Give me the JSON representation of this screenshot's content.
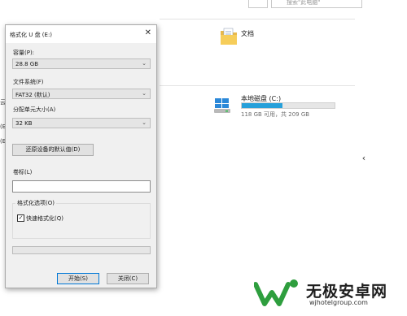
{
  "explorer": {
    "search_placeholder": "搜索\"此电脑\"",
    "folders": [
      {
        "name": "文档",
        "icon": "document-folder-icon"
      }
    ],
    "drives": [
      {
        "name": "本地磁盘 (C:)",
        "usage": "118 GB 可用，共 209 GB",
        "used_fraction": 0.44,
        "icon": "hard-drive-icon"
      }
    ],
    "left_remnants": [
      "云",
      "(E",
      "(E"
    ],
    "colors": {
      "drive_bar": "#26a0da",
      "background": "#ffffff"
    }
  },
  "dialog": {
    "title": "格式化 U 盘 (E:)",
    "capacity": {
      "label": "容量(P):",
      "value": "28.8 GB"
    },
    "filesystem": {
      "label": "文件系统(F)",
      "value": "FAT32 (默认)"
    },
    "allocation": {
      "label": "分配单元大小(A)",
      "value": "32 KB"
    },
    "restore_defaults": "还原设备的默认值(D)",
    "volume_label": {
      "label": "卷标(L)",
      "value": ""
    },
    "options": {
      "group_label": "格式化选项(O)",
      "quick_format": {
        "label": "快速格式化(Q)",
        "checked": true
      }
    },
    "progress": 0,
    "start_button": "开始(S)",
    "close_button": "关闭(C)"
  },
  "watermark": {
    "title": "无极安卓网",
    "url": "wjhotelgroup.com"
  }
}
